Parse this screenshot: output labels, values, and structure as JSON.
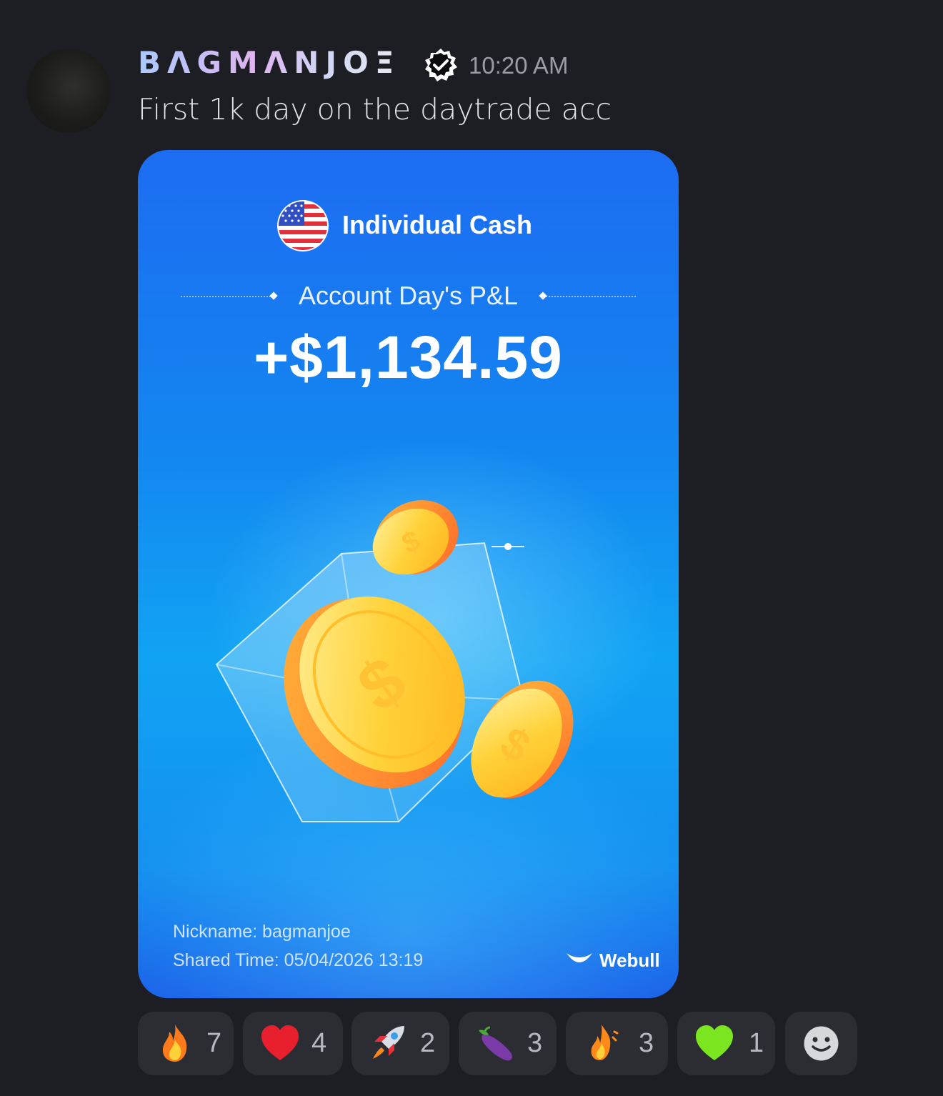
{
  "message": {
    "username": "BΛGMΛNJOΞ",
    "timestamp": "10:20 AM",
    "text": "First 1k day on the daytrade acc"
  },
  "card": {
    "account_name": "Individual Cash",
    "pl_label": "Account Day's P&L",
    "pl_value": "+$1,134.59",
    "nickname": "Nickname: bagmanjoe",
    "shared_time": "Shared Time: 05/04/2026 13:19",
    "brand": "Webull"
  },
  "reactions": [
    {
      "emoji": "fire-icon",
      "count": "7"
    },
    {
      "emoji": "red-heart-icon",
      "count": "4"
    },
    {
      "emoji": "rocket-icon",
      "count": "2"
    },
    {
      "emoji": "eggplant-icon",
      "count": "3"
    },
    {
      "emoji": "fire-swirl-icon",
      "count": "3"
    },
    {
      "emoji": "green-heart-icon",
      "count": "1"
    }
  ],
  "colors": {
    "background": "#1d1e23",
    "card_blue": "#1386f0",
    "reaction_bg": "#2c2d33",
    "profit_text": "#ffffff"
  }
}
